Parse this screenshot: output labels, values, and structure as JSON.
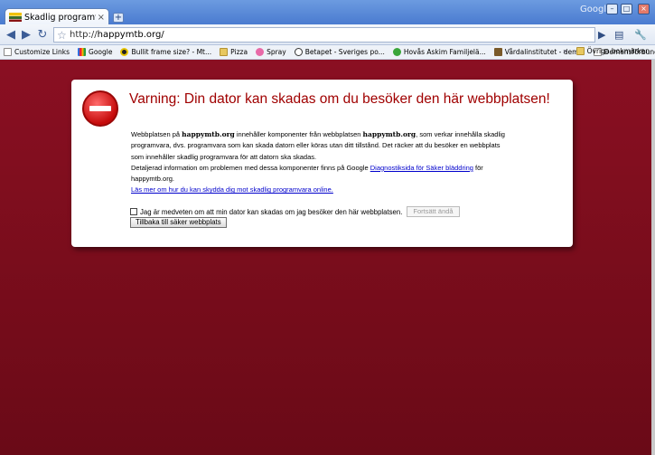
{
  "window": {
    "tab_title": "Skadlig programvara har u...",
    "tab_close": "×",
    "new_tab": "+",
    "brand": "Google",
    "controls": {
      "minimize": "–",
      "maximize": "□",
      "close": "×"
    }
  },
  "toolbar": {
    "back": "◀",
    "forward": "▶",
    "reload": "↻",
    "url_prefix": "http://",
    "url_host": "happymtb.org/",
    "star": "☆",
    "go": "▶",
    "page_menu": "▤",
    "tools_menu": "🔧"
  },
  "bookmarks": {
    "items": [
      {
        "label": "Customize Links"
      },
      {
        "label": "Google"
      },
      {
        "label": "Bullit frame size? - Mt..."
      },
      {
        "label": "Pizza"
      },
      {
        "label": "Spray"
      },
      {
        "label": "Betapet - Sveriges po..."
      },
      {
        "label": "Hovås Askim Familjelä..."
      },
      {
        "label": "Vårdalinstitutet - dem..."
      },
      {
        "label": "Demensförbundet"
      }
    ],
    "more": "»",
    "other": "Övriga bokmärken"
  },
  "warning": {
    "heading": "Varning: Din dator kan skadas om du besöker den här webbplatsen!",
    "p1_a": "Webbplatsen på ",
    "p1_b": "happymtb.org",
    "p1_c": " innehåller komponenter från webbplatsen ",
    "p1_d": "happymtb.org",
    "p1_e": ", som verkar innehålla skadlig programvara, dvs. programvara som kan skada datorn eller köras utan ditt tillstånd. Det räcker att du besöker en webbplats som innehåller skadlig programvara för att datorn ska skadas.",
    "p2_a": "Detaljerad information om problemen med dessa komponenter finns på Google ",
    "p2_link": "Diagnostiksida för Säker bläddring",
    "p2_b": " för happymtb.org.",
    "learn_more": "Läs mer om hur du kan skydda dig mot skadlig programvara online.",
    "checkbox_label": "Jag är medveten om att min dator kan skadas om jag besöker den här webbplatsen.",
    "continue_button": "Fortsätt ändå",
    "back_button": "Tillbaka till säker webbplats"
  }
}
